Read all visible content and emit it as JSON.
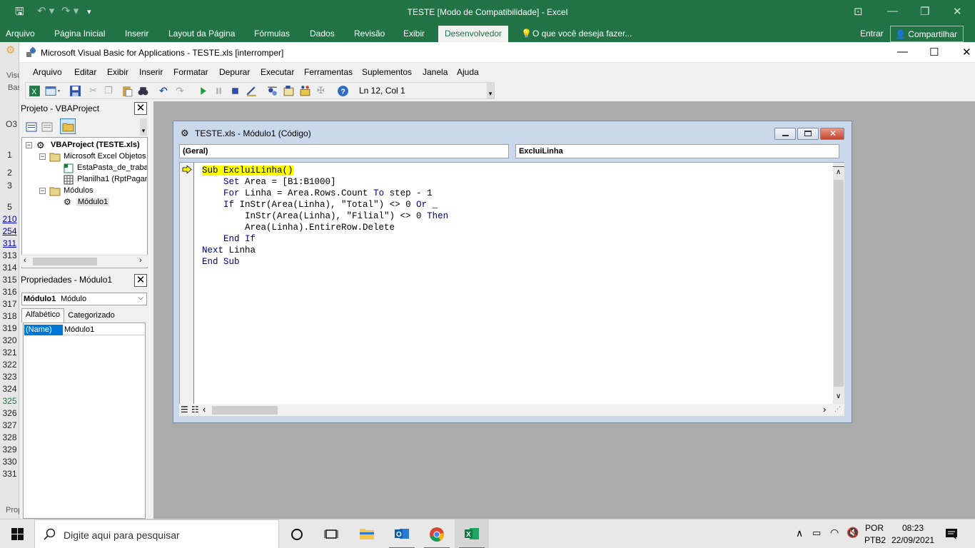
{
  "excel": {
    "title": "TESTE  [Modo de Compatibilidade] - Excel",
    "tabs": [
      "Arquivo",
      "Página Inicial",
      "Inserir",
      "Layout da Página",
      "Fórmulas",
      "Dados",
      "Revisão",
      "Exibir",
      "Desenvolvedor"
    ],
    "active_tab": "Desenvolvedor",
    "tell_me": "O que você deseja fazer...",
    "signin": "Entrar",
    "share": "Compartilhar",
    "row_headers": [
      "1",
      "2",
      "3",
      "",
      "5",
      "210",
      "254",
      "311",
      "313",
      "314",
      "315",
      "316",
      "317",
      "318",
      "319",
      "320",
      "321",
      "322",
      "323",
      "324",
      "325",
      "326",
      "327",
      "328",
      "329",
      "330",
      "331"
    ],
    "namebox_fragment": "O3",
    "fragment_vis": "Visu",
    "fragment_bas": "Bas",
    "fragment_prop": "Prop"
  },
  "vbe": {
    "title": "Microsoft Visual Basic for Applications - TESTE.xls [interromper]",
    "menu": [
      "Arquivo",
      "Editar",
      "Exibir",
      "Inserir",
      "Formatar",
      "Depurar",
      "Executar",
      "Ferramentas",
      "Suplementos",
      "Janela",
      "Ajuda"
    ],
    "cursor_position": "Ln 12, Col 1",
    "project": {
      "title": "Projeto - VBAProject",
      "root": "VBAProject (TESTE.xls)",
      "folder_objects": "Microsoft Excel Objetos",
      "objects": [
        "EstaPasta_de_traba",
        "Planilha1 (RptPagam"
      ],
      "folder_modules": "Módulos",
      "modules": [
        "Módulo1"
      ]
    },
    "properties": {
      "title": "Propriedades - Módulo1",
      "object_name": "Módulo1",
      "object_type": "Módulo",
      "tab_alpha": "Alfabético",
      "tab_cat": "Categorizado",
      "prop_name": "(Name)",
      "prop_value": "Módulo1"
    },
    "code_window": {
      "title": "TESTE.xls - Módulo1 (Código)",
      "object_combo": "(Geral)",
      "proc_combo": "ExcluiLinha",
      "lines": [
        "Sub ExcluiLinha()",
        "    Set Area = [B1:B1000]",
        "",
        "    For Linha = Area.Rows.Count To step - 1",
        "    If InStr(Area(Linha), \"Total\") <> 0 Or _",
        "        InStr(Area(Linha), \"Filial\") <> 0 Then",
        "        Area(Linha).EntireRow.Delete",
        "    End If",
        "Next Linha",
        "End Sub"
      ]
    }
  },
  "taskbar": {
    "search_placeholder": "Digite aqui para pesquisar",
    "lang_top": "POR",
    "lang_bottom": "PTB2",
    "time": "08:23",
    "date": "22/09/2021"
  }
}
